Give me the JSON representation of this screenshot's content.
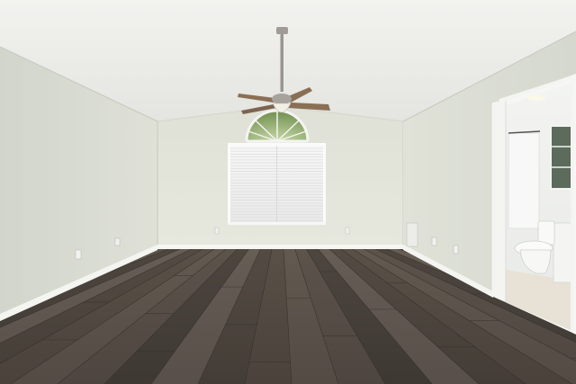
{
  "photo": {
    "subject": "empty-room-interior",
    "colors": {
      "ceiling": "#efefec",
      "wall_left": "#d9dbd1",
      "wall_back": "#e2e4da",
      "wall_right": "#dcded4",
      "baseboard": "#f4f4f1",
      "floor_dark": "#3f3a35",
      "floor_mid": "#5b524a",
      "floor_light": "#6e655c",
      "window_blind": "#f3f3f3",
      "fan_metal": "#9a968f",
      "fan_blade": "#8a6f55",
      "bathroom_floor": "#e8e2d6",
      "tile": "#eef0ee"
    }
  }
}
